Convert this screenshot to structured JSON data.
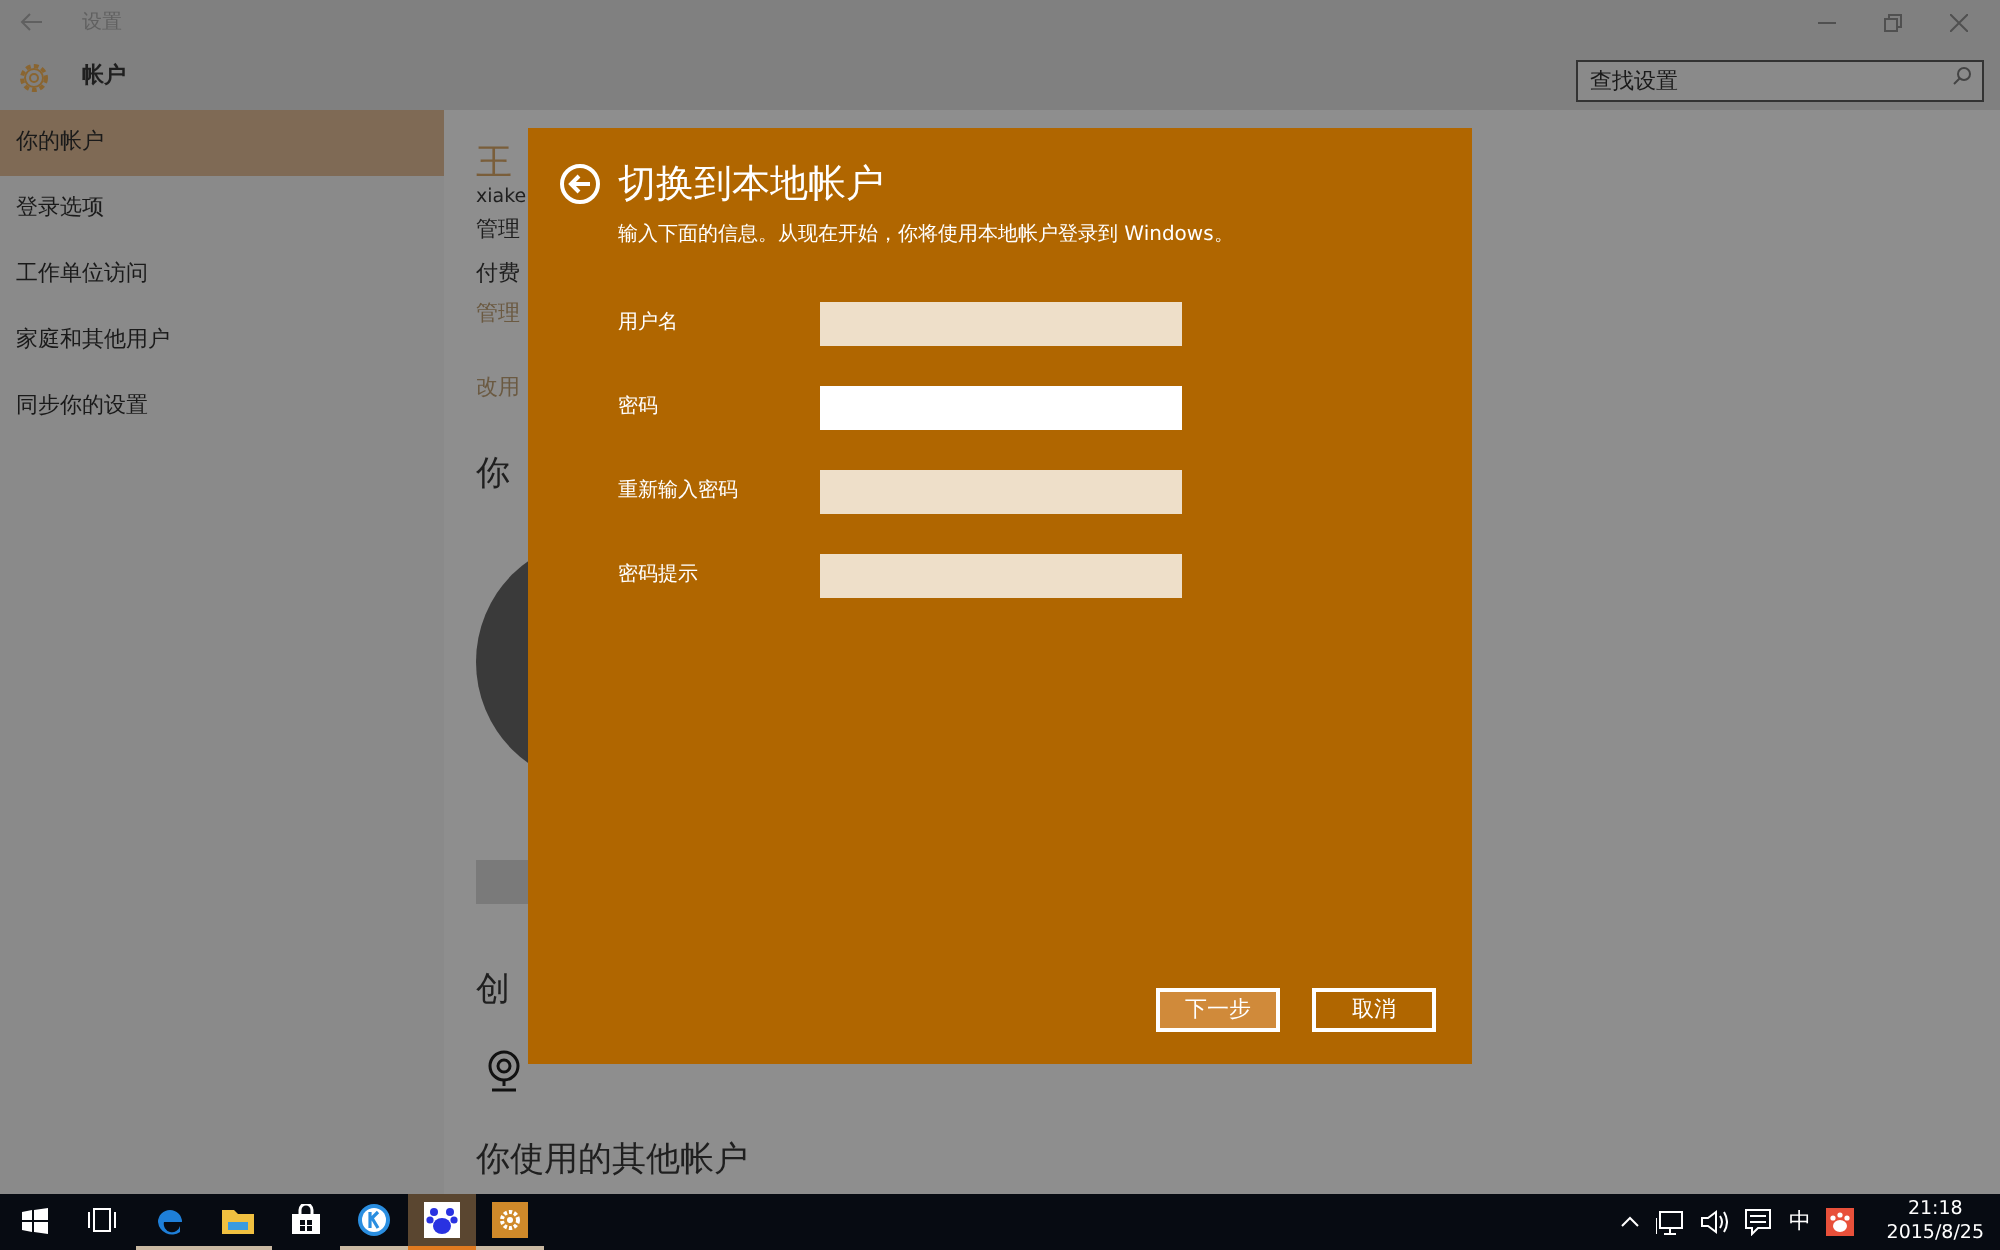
{
  "window": {
    "title": "设置"
  },
  "header": {
    "title": "帐户",
    "search": {
      "placeholder": "查找设置"
    }
  },
  "sidebar": {
    "items": [
      {
        "label": "你的帐户",
        "selected": true
      },
      {
        "label": "登录选项",
        "selected": false
      },
      {
        "label": "工作单位访问",
        "selected": false
      },
      {
        "label": "家庭和其他用户",
        "selected": false
      },
      {
        "label": "同步你的设置",
        "selected": false
      }
    ]
  },
  "content": {
    "user_name": "王",
    "email": "xiake",
    "role": "管理",
    "billing": "付费",
    "manage_link": "管理",
    "switch_link": "改用",
    "picture_heading": "你",
    "create_heading": "创",
    "other_accounts_heading": "你使用的其他帐户"
  },
  "dialog": {
    "title": "切换到本地帐户",
    "subtitle": "输入下面的信息。从现在开始，你将使用本地帐户登录到 Windows。",
    "fields": [
      {
        "label": "用户名",
        "focused": false
      },
      {
        "label": "密码",
        "focused": true
      },
      {
        "label": "重新输入密码",
        "focused": false
      },
      {
        "label": "密码提示",
        "focused": false
      }
    ],
    "buttons": [
      {
        "label": "下一步",
        "kind": "primary"
      },
      {
        "label": "取消",
        "kind": "secondary"
      }
    ]
  },
  "taskbar": {
    "apps": [
      {
        "kind": "start",
        "open": false,
        "selected": false
      },
      {
        "kind": "task-view",
        "open": false,
        "selected": false
      },
      {
        "kind": "edge",
        "open": true,
        "selected": false
      },
      {
        "kind": "explorer",
        "open": true,
        "selected": false
      },
      {
        "kind": "store",
        "open": false,
        "selected": false
      },
      {
        "kind": "k-app",
        "open": true,
        "selected": false
      },
      {
        "kind": "paw-app",
        "open": true,
        "selected": true
      },
      {
        "kind": "settings",
        "open": true,
        "selected": false
      }
    ],
    "ime": "中",
    "time": "21:18",
    "date": "2015/8/25"
  }
}
